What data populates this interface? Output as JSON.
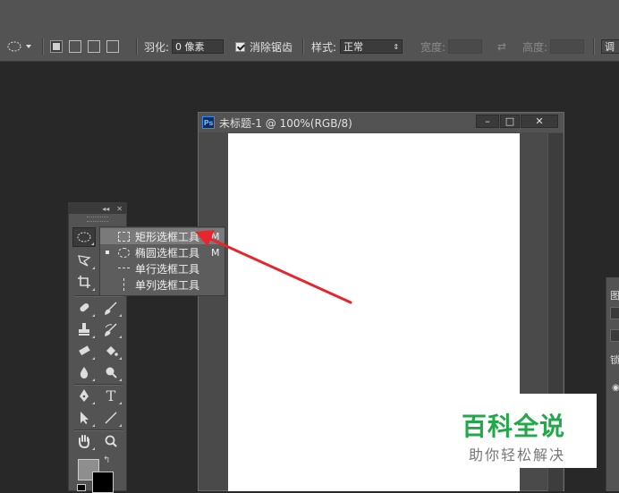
{
  "options_bar": {
    "feather_label": "羽化:",
    "feather_value": "0 像素",
    "antialias_label": "消除锯齿",
    "style_label": "样式:",
    "style_value": "正常",
    "width_label": "宽度:",
    "height_label": "高度:",
    "refine_button": "调"
  },
  "document": {
    "title": "未标题-1 @ 100%(RGB/8)",
    "app_badge": "Ps",
    "minimize": "–",
    "maximize": "□",
    "close": "✕"
  },
  "toolbox": {
    "header_collapse": "◂◂",
    "header_close": "✕"
  },
  "flyout": {
    "items": [
      {
        "label": "矩形选框工具",
        "shortcut": "M"
      },
      {
        "label": "椭圆选框工具",
        "shortcut": "M"
      },
      {
        "label": "单行选框工具",
        "shortcut": ""
      },
      {
        "label": "单列选框工具",
        "shortcut": ""
      }
    ]
  },
  "right_panel": {
    "tab_fragment": "图",
    "row_fragment": "锁"
  },
  "watermark": {
    "title": "百科全说",
    "subtitle": "助你轻松解决"
  },
  "colors": {
    "annotation_arrow": "#e8252b",
    "watermark_green": "#22a84a"
  }
}
